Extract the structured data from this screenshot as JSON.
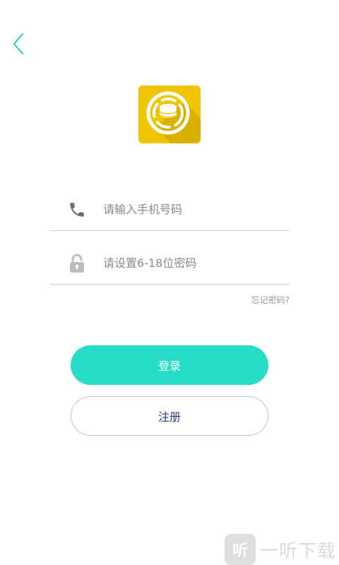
{
  "colors": {
    "accent": "#27dcc8",
    "back_arrow": "#27c6c0",
    "logo_bg": "#f1c400",
    "logo_shadow": "#c9a200",
    "register_text": "#2b3a7a",
    "register_border": "#b8bfd8",
    "icon_gray": "#7a7a7a",
    "divider": "#cfcfcf"
  },
  "icons": {
    "back": "chevron-left-icon",
    "logo": "coin-stack-logo-icon",
    "phone": "phone-icon",
    "password": "lock-icon"
  },
  "form": {
    "phone": {
      "value": "",
      "placeholder": "请输入手机号码"
    },
    "password": {
      "value": "",
      "placeholder": "请设置6-18位密码"
    },
    "forgot_label": "忘记密码?"
  },
  "buttons": {
    "login_label": "登录",
    "register_label": "注册"
  },
  "watermark": {
    "icon_char": "听",
    "text": "一听下载"
  }
}
